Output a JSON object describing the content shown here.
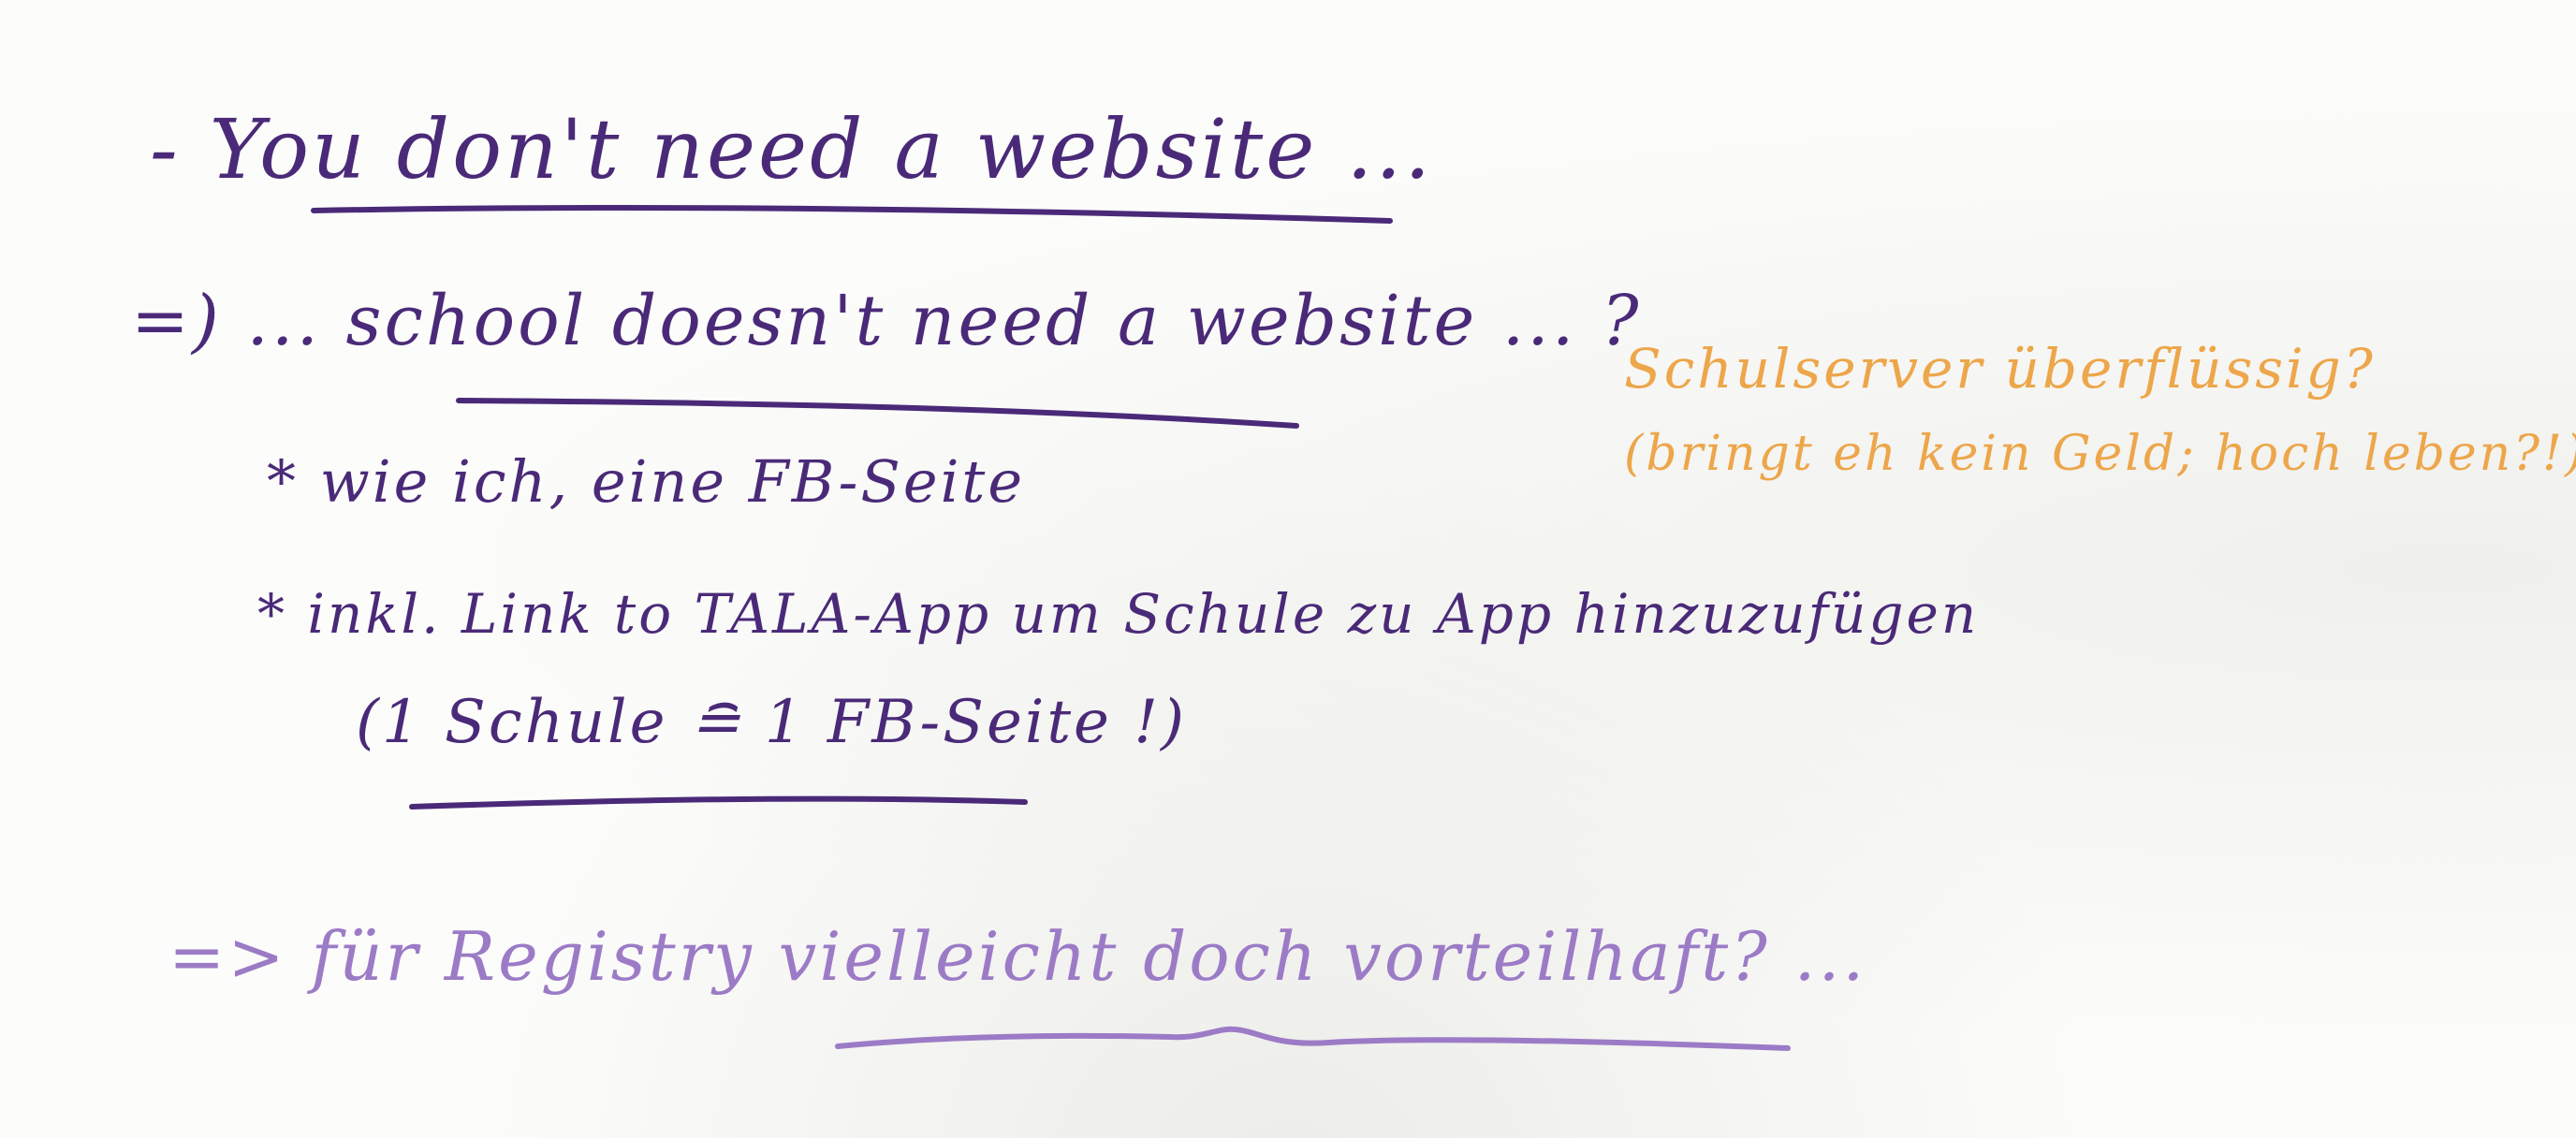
{
  "note": {
    "line1": "- You don't need a website ...",
    "line2": "=) ... school doesn't need a website ... ?",
    "line3": "* wie ich, eine FB-Seite",
    "line4": "* inkl. Link to TALA-App um Schule zu App hinzuzufügen",
    "line5": "(1 Schule ≘ 1 FB-Seite !)",
    "line6": "=> für Registry vielleicht doch vorteilhaft? ...",
    "side_line1": "Schulserver überflüssig?",
    "side_line2": "(bringt eh kein Geld; hoch leben?!)"
  },
  "colors": {
    "dark_ink": "#4a2a78",
    "light_ink": "#9c7bc6",
    "orange_ink": "#eda64a",
    "paper": "#fcfcfb"
  }
}
